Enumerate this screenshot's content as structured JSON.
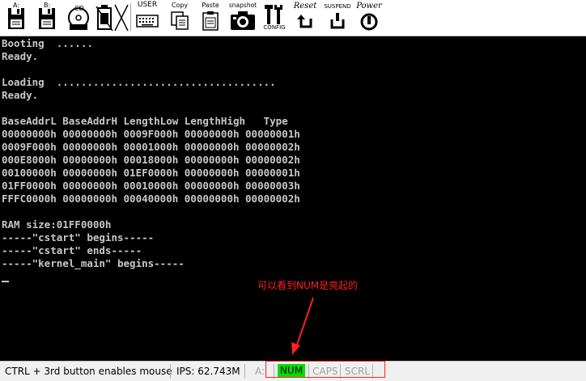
{
  "toolbar": {
    "buttons": [
      {
        "id": "floppy-a",
        "label": "A:",
        "icon": "floppy-disk-icon"
      },
      {
        "id": "floppy-b",
        "label": "B:",
        "icon": "floppy-disk-icon"
      },
      {
        "id": "cdrom",
        "label": "CD",
        "icon": "cdrom-icon"
      },
      {
        "id": "usb",
        "label": "",
        "icon": "usb-device-icon"
      },
      {
        "id": "mouse",
        "label": "",
        "icon": "mouse-disabled-icon"
      },
      {
        "id": "user",
        "label": "USER",
        "icon": "keyboard-icon"
      },
      {
        "id": "copy",
        "label": "Copy",
        "icon": "copy-icon"
      },
      {
        "id": "paste",
        "label": "Paste",
        "icon": "paste-icon"
      },
      {
        "id": "snapshot",
        "label": "snapshot",
        "icon": "camera-icon"
      },
      {
        "id": "config",
        "label": "CONFIG",
        "icon": "config-tools-icon"
      },
      {
        "id": "reset",
        "label": "Reset",
        "icon": "reset-icon"
      },
      {
        "id": "suspend",
        "label": "SUSPEND",
        "icon": "suspend-icon"
      },
      {
        "id": "power",
        "label": "Power",
        "icon": "power-icon"
      }
    ]
  },
  "console": {
    "lines": [
      "Booting  ......",
      "Ready.",
      "",
      "Loading  ....................................",
      "Ready.",
      "",
      "BaseAddrL BaseAddrH LengthLow LengthHigh   Type",
      "00000000h 00000000h 0009F000h 00000000h 00000001h",
      "0009F000h 00000000h 00001000h 00000000h 00000002h",
      "000E8000h 00000000h 00018000h 00000000h 00000002h",
      "00100000h 00000000h 01EF0000h 00000000h 00000001h",
      "01FF0000h 00000000h 00010000h 00000000h 00000003h",
      "FFFC0000h 00000000h 00040000h 00000000h 00000002h",
      "",
      "RAM size:01FF0000h",
      "-----\"cstart\" begins-----",
      "-----\"cstart\" ends-----",
      "-----\"kernel_main\" begins-----"
    ],
    "text_color": "#c8c8c8",
    "background": "#000000"
  },
  "annotation": {
    "text": "可以看到NUM是亮起的",
    "color": "#ff2020"
  },
  "statusbar": {
    "mouse_hint": "CTRL + 3rd button enables mouse",
    "ips": "IPS: 62.743M",
    "drive": "A:",
    "num": "NUM",
    "caps": "CAPS",
    "scrl": "SCRL",
    "num_color": "#00e000"
  }
}
